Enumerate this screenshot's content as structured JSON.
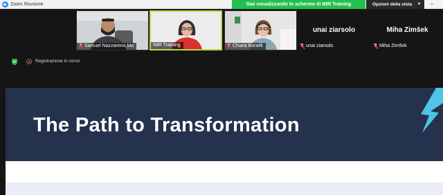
{
  "window": {
    "app_title": "Zoom Riunione",
    "share_banner": "Stai visualizzando lo schermo di IMR Training",
    "view_options_label": "Opzioni della vista",
    "minimize_glyph": "–"
  },
  "participants": [
    {
      "name": "Samuel Nazzareno Mo",
      "video": true,
      "muted": true
    },
    {
      "name": "IMR Training",
      "video": true,
      "muted": false,
      "active": true
    },
    {
      "name": "Chiara Bonelli",
      "video": true,
      "muted": true
    },
    {
      "name": "unai ziarsolo",
      "video": false,
      "muted": true
    },
    {
      "name": "Miha Zimšek",
      "video": false,
      "muted": true
    }
  ],
  "status": {
    "recording_label": "Registrazione in corso"
  },
  "slide": {
    "title": "The Path to Transformation"
  },
  "colors": {
    "share_green": "#21c04f",
    "slide_banner": "#24324d",
    "active_speaker": "#b7d84a",
    "accent_teal": "#4fc3e8"
  }
}
